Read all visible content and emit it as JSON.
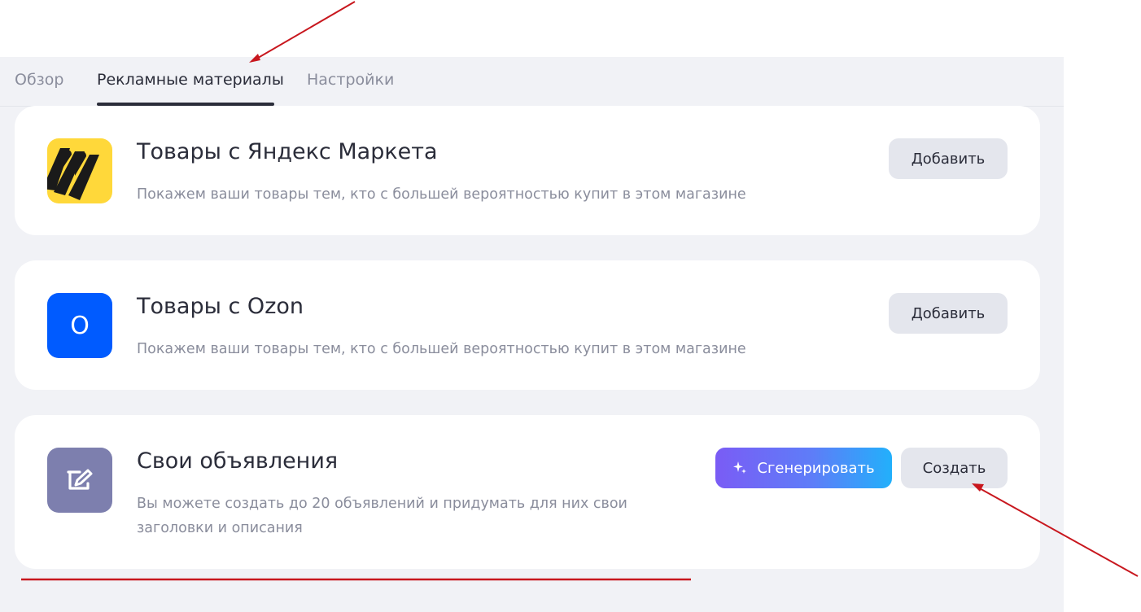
{
  "tabs": [
    {
      "label": "Обзор"
    },
    {
      "label": "Рекламные материалы"
    },
    {
      "label": "Настройки"
    }
  ],
  "cards": {
    "market": {
      "title": "Товары с Яндекс Маркета",
      "description": "Покажем ваши товары тем, кто с большей вероятностью купит в этом магазине",
      "button": "Добавить",
      "logo_color": "#ffd83a"
    },
    "ozon": {
      "title": "Товары с Ozon",
      "description": "Покажем ваши товары тем, кто с большей вероятностью купит в этом магазине",
      "button": "Добавить",
      "logo_letter": "O",
      "logo_color": "#005bff"
    },
    "own": {
      "title": "Свои объявления",
      "description_line1": "Вы можете создать до 20 объявлений и придумать для них свои",
      "description_line2": "заголовки и описания",
      "generate_button": "Сгенерировать",
      "create_button": "Создать",
      "logo_color": "#7d7fae"
    }
  },
  "colors": {
    "annotation": "#c8171e",
    "panel_bg": "#f1f2f6",
    "card_bg": "#ffffff",
    "button_bg": "#e4e6ed"
  }
}
